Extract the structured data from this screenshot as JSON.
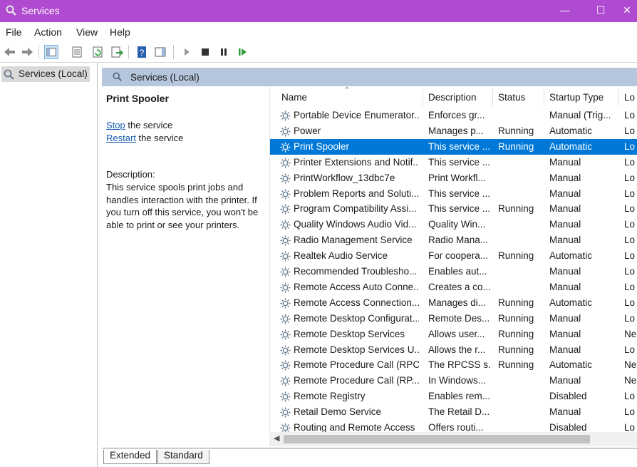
{
  "window": {
    "title": "Services",
    "minimize_glyph": "—",
    "maximize_glyph": "☐",
    "close_glyph": "✕",
    "accent": "#b04ad0"
  },
  "menu": {
    "file": "File",
    "action": "Action",
    "view": "View",
    "help": "Help"
  },
  "tree": {
    "root_label": "Services (Local)"
  },
  "pane": {
    "header_label": "Services (Local)",
    "selected_title": "Print Spooler",
    "stop_link": "Stop",
    "stop_rest": " the service",
    "restart_link": "Restart",
    "restart_rest": " the service",
    "description_label": "Description:",
    "description_text": "This service spools print jobs and handles interaction with the printer. If you turn off this service, you won't be able to print or see your printers."
  },
  "list": {
    "columns": {
      "name": "Name",
      "description": "Description",
      "status": "Status",
      "startup": "Startup Type",
      "logon": "Lo"
    },
    "rows": [
      {
        "name": "Portable Device Enumerator...",
        "description": "Enforces gr...",
        "status": "",
        "startup": "Manual (Trig...",
        "logon": "Lo"
      },
      {
        "name": "Power",
        "description": "Manages p...",
        "status": "Running",
        "startup": "Automatic",
        "logon": "Lo"
      },
      {
        "name": "Print Spooler",
        "description": "This service ...",
        "status": "Running",
        "startup": "Automatic",
        "logon": "Lo"
      },
      {
        "name": "Printer Extensions and Notif...",
        "description": "This service ...",
        "status": "",
        "startup": "Manual",
        "logon": "Lo"
      },
      {
        "name": "PrintWorkflow_13dbc7e",
        "description": "Print Workfl...",
        "status": "",
        "startup": "Manual",
        "logon": "Lo"
      },
      {
        "name": "Problem Reports and Soluti...",
        "description": "This service ...",
        "status": "",
        "startup": "Manual",
        "logon": "Lo"
      },
      {
        "name": "Program Compatibility Assi...",
        "description": "This service ...",
        "status": "Running",
        "startup": "Manual",
        "logon": "Lo"
      },
      {
        "name": "Quality Windows Audio Vid...",
        "description": "Quality Win...",
        "status": "",
        "startup": "Manual",
        "logon": "Lo"
      },
      {
        "name": "Radio Management Service",
        "description": "Radio Mana...",
        "status": "",
        "startup": "Manual",
        "logon": "Lo"
      },
      {
        "name": "Realtek Audio Service",
        "description": "For coopera...",
        "status": "Running",
        "startup": "Automatic",
        "logon": "Lo"
      },
      {
        "name": "Recommended Troublesho...",
        "description": "Enables aut...",
        "status": "",
        "startup": "Manual",
        "logon": "Lo"
      },
      {
        "name": "Remote Access Auto Conne...",
        "description": "Creates a co...",
        "status": "",
        "startup": "Manual",
        "logon": "Lo"
      },
      {
        "name": "Remote Access Connection...",
        "description": "Manages di...",
        "status": "Running",
        "startup": "Automatic",
        "logon": "Lo"
      },
      {
        "name": "Remote Desktop Configurat...",
        "description": "Remote Des...",
        "status": "Running",
        "startup": "Manual",
        "logon": "Lo"
      },
      {
        "name": "Remote Desktop Services",
        "description": "Allows user...",
        "status": "Running",
        "startup": "Manual",
        "logon": "Ne"
      },
      {
        "name": "Remote Desktop Services U...",
        "description": "Allows the r...",
        "status": "Running",
        "startup": "Manual",
        "logon": "Lo"
      },
      {
        "name": "Remote Procedure Call (RPC)",
        "description": "The RPCSS s...",
        "status": "Running",
        "startup": "Automatic",
        "logon": "Ne"
      },
      {
        "name": "Remote Procedure Call (RP...",
        "description": "In Windows...",
        "status": "",
        "startup": "Manual",
        "logon": "Ne"
      },
      {
        "name": "Remote Registry",
        "description": "Enables rem...",
        "status": "",
        "startup": "Disabled",
        "logon": "Lo"
      },
      {
        "name": "Retail Demo Service",
        "description": "The Retail D...",
        "status": "",
        "startup": "Manual",
        "logon": "Lo"
      },
      {
        "name": "Routing and Remote Access",
        "description": "Offers routi...",
        "status": "",
        "startup": "Disabled",
        "logon": "Lo"
      }
    ],
    "selected_index": 2,
    "selection_color": "#0078d7"
  },
  "tabs": {
    "extended": "Extended",
    "standard": "Standard"
  },
  "icons": {
    "app": "services-gear-magnifier-icon",
    "back": "back-arrow-icon",
    "forward": "forward-arrow-icon",
    "start": "play-icon",
    "stop": "stop-icon",
    "pause": "pause-icon",
    "restart": "restart-icon"
  }
}
